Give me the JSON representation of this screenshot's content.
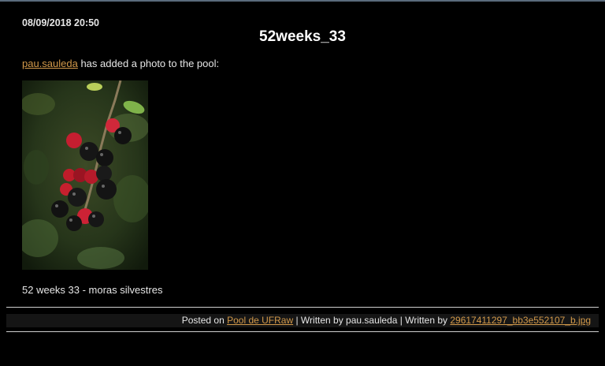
{
  "post": {
    "date": "08/09/2018 20:50",
    "title": "52weeks_33",
    "author_link": "pau.sauleda",
    "intro_text": " has added a photo to the pool:",
    "caption": "52 weeks 33 - moras silvestres"
  },
  "footer": {
    "posted_on": "Posted on ",
    "pool_link": "Pool de UFRaw",
    "written_by_1": " | Written by pau.sauleda | Written by ",
    "file_link": "29617411297_bb3e552107_b.jpg"
  },
  "colors": {
    "link": "#d2994a",
    "background": "#000000"
  }
}
